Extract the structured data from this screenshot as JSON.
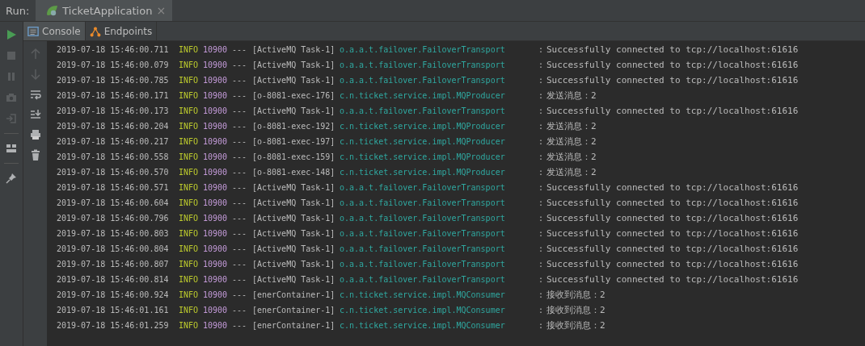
{
  "run_bar": {
    "label": "Run:",
    "tabs": [
      {
        "label": "TicketApplication",
        "close": "×",
        "selected": true
      }
    ]
  },
  "console_tabs": [
    {
      "label": "Console",
      "kind": "console",
      "selected": true
    },
    {
      "label": "Endpoints",
      "kind": "endpoints",
      "selected": false
    }
  ],
  "log_lines": [
    {
      "time": "2019-07-18 15:46:00.711",
      "level": "INFO",
      "pid": "10900",
      "sep": "---",
      "thread": "[ActiveMQ Task-1]",
      "logger": "o.a.a.t.failover.FailoverTransport",
      "colon": ":",
      "message": "Successfully connected to tcp://localhost:61616"
    },
    {
      "time": "2019-07-18 15:46:00.079",
      "level": "INFO",
      "pid": "10900",
      "sep": "---",
      "thread": "[ActiveMQ Task-1]",
      "logger": "o.a.a.t.failover.FailoverTransport",
      "colon": ":",
      "message": "Successfully connected to tcp://localhost:61616"
    },
    {
      "time": "2019-07-18 15:46:00.785",
      "level": "INFO",
      "pid": "10900",
      "sep": "---",
      "thread": "[ActiveMQ Task-1]",
      "logger": "o.a.a.t.failover.FailoverTransport",
      "colon": ":",
      "message": "Successfully connected to tcp://localhost:61616"
    },
    {
      "time": "2019-07-18 15:46:00.171",
      "level": "INFO",
      "pid": "10900",
      "sep": "---",
      "thread": "[o-8081-exec-176]",
      "logger": "c.n.ticket.service.impl.MQProducer",
      "colon": ":",
      "message": "发送消息：2"
    },
    {
      "time": "2019-07-18 15:46:00.173",
      "level": "INFO",
      "pid": "10900",
      "sep": "---",
      "thread": "[ActiveMQ Task-1]",
      "logger": "o.a.a.t.failover.FailoverTransport",
      "colon": ":",
      "message": "Successfully connected to tcp://localhost:61616"
    },
    {
      "time": "2019-07-18 15:46:00.204",
      "level": "INFO",
      "pid": "10900",
      "sep": "---",
      "thread": "[o-8081-exec-192]",
      "logger": "c.n.ticket.service.impl.MQProducer",
      "colon": ":",
      "message": "发送消息：2"
    },
    {
      "time": "2019-07-18 15:46:00.217",
      "level": "INFO",
      "pid": "10900",
      "sep": "---",
      "thread": "[o-8081-exec-197]",
      "logger": "c.n.ticket.service.impl.MQProducer",
      "colon": ":",
      "message": "发送消息：2"
    },
    {
      "time": "2019-07-18 15:46:00.558",
      "level": "INFO",
      "pid": "10900",
      "sep": "---",
      "thread": "[o-8081-exec-159]",
      "logger": "c.n.ticket.service.impl.MQProducer",
      "colon": ":",
      "message": "发送消息：2"
    },
    {
      "time": "2019-07-18 15:46:00.570",
      "level": "INFO",
      "pid": "10900",
      "sep": "---",
      "thread": "[o-8081-exec-148]",
      "logger": "c.n.ticket.service.impl.MQProducer",
      "colon": ":",
      "message": "发送消息：2"
    },
    {
      "time": "2019-07-18 15:46:00.571",
      "level": "INFO",
      "pid": "10900",
      "sep": "---",
      "thread": "[ActiveMQ Task-1]",
      "logger": "o.a.a.t.failover.FailoverTransport",
      "colon": ":",
      "message": "Successfully connected to tcp://localhost:61616"
    },
    {
      "time": "2019-07-18 15:46:00.604",
      "level": "INFO",
      "pid": "10900",
      "sep": "---",
      "thread": "[ActiveMQ Task-1]",
      "logger": "o.a.a.t.failover.FailoverTransport",
      "colon": ":",
      "message": "Successfully connected to tcp://localhost:61616"
    },
    {
      "time": "2019-07-18 15:46:00.796",
      "level": "INFO",
      "pid": "10900",
      "sep": "---",
      "thread": "[ActiveMQ Task-1]",
      "logger": "o.a.a.t.failover.FailoverTransport",
      "colon": ":",
      "message": "Successfully connected to tcp://localhost:61616"
    },
    {
      "time": "2019-07-18 15:46:00.803",
      "level": "INFO",
      "pid": "10900",
      "sep": "---",
      "thread": "[ActiveMQ Task-1]",
      "logger": "o.a.a.t.failover.FailoverTransport",
      "colon": ":",
      "message": "Successfully connected to tcp://localhost:61616"
    },
    {
      "time": "2019-07-18 15:46:00.804",
      "level": "INFO",
      "pid": "10900",
      "sep": "---",
      "thread": "[ActiveMQ Task-1]",
      "logger": "o.a.a.t.failover.FailoverTransport",
      "colon": ":",
      "message": "Successfully connected to tcp://localhost:61616"
    },
    {
      "time": "2019-07-18 15:46:00.807",
      "level": "INFO",
      "pid": "10900",
      "sep": "---",
      "thread": "[ActiveMQ Task-1]",
      "logger": "o.a.a.t.failover.FailoverTransport",
      "colon": ":",
      "message": "Successfully connected to tcp://localhost:61616"
    },
    {
      "time": "2019-07-18 15:46:00.814",
      "level": "INFO",
      "pid": "10900",
      "sep": "---",
      "thread": "[ActiveMQ Task-1]",
      "logger": "o.a.a.t.failover.FailoverTransport",
      "colon": ":",
      "message": "Successfully connected to tcp://localhost:61616"
    },
    {
      "time": "2019-07-18 15:46:00.924",
      "level": "INFO",
      "pid": "10900",
      "sep": "---",
      "thread": "[enerContainer-1]",
      "logger": "c.n.ticket.service.impl.MQConsumer",
      "colon": ":",
      "message": "接收到消息：2"
    },
    {
      "time": "2019-07-18 15:46:01.161",
      "level": "INFO",
      "pid": "10900",
      "sep": "---",
      "thread": "[enerContainer-1]",
      "logger": "c.n.ticket.service.impl.MQConsumer",
      "colon": ":",
      "message": "接收到消息：2"
    },
    {
      "time": "2019-07-18 15:46:01.259",
      "level": "INFO",
      "pid": "10900",
      "sep": "---",
      "thread": "[enerContainer-1]",
      "logger": "c.n.ticket.service.impl.MQConsumer",
      "colon": ":",
      "message": "接收到消息：2"
    }
  ]
}
